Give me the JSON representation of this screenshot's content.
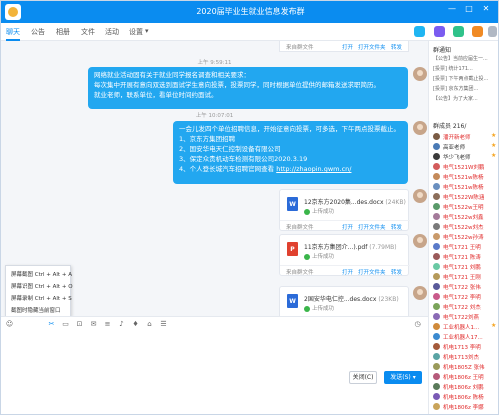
{
  "window": {
    "title": "2020届毕业生就业信息发布群",
    "controls": [
      "—",
      "□",
      "✕"
    ]
  },
  "tabs": [
    {
      "label": "聊天",
      "active": true
    },
    {
      "label": "公告"
    },
    {
      "label": "相册"
    },
    {
      "label": "文件"
    },
    {
      "label": "活动"
    },
    {
      "label": "设置"
    }
  ],
  "tab_settings_caret": "▾",
  "chat": {
    "top_file_footer": {
      "source": "来自群文件",
      "open": "打开",
      "open_folder": "打开文件夹",
      "forward": "转发"
    },
    "time1": "上午 9:59:11",
    "message1": [
      "网络就业活动固有关于就业同学报名调查和相关要求：",
      "每次集中开展有意向双选到面试学生意向投票，投票同学，同时根据单位提供的邮箱发送求职简历。",
      "就业老师，联系单位，看单位时间约面试。"
    ],
    "time2": "上午 10:07:01",
    "message2": {
      "intro": "一会儿发四个单位招聘信息，开始征意向投票，可多选，下午两点投票截止。",
      "items": [
        "1、京东方集团招聘",
        "2、国安华电天仁控制设备有限公司",
        "3、保定众贵机动车检测有限公司2020.3.19",
        "4、个人登长城汽车招聘官网查看"
      ],
      "link": "http://zhaopin.gwm.cn/"
    },
    "files": [
      {
        "name": "12京东方2020集...des.docx",
        "size": "(24KB)",
        "status": "上传成功",
        "type": "word"
      },
      {
        "name": "11京东方集团介...).pdf",
        "size": "(7.79MB)",
        "status": "上传成功",
        "type": "pdf"
      },
      {
        "name": "2国安华电仁控...des.docx",
        "size": "(23KB)",
        "status": "上传成功",
        "type": "word"
      }
    ],
    "file_footer": {
      "source": "来自群文件",
      "open": "打开",
      "open_folder": "打开文件夹",
      "forward": "转发"
    }
  },
  "context_menu": {
    "items": [
      "屏幕截图 Ctrl + Alt + A",
      "屏幕识图 Ctrl + Alt + O",
      "屏幕录制 Ctrl + Alt + S",
      "截图时隐藏当前窗口"
    ]
  },
  "toolbar": {
    "icons": [
      "☺",
      "✂",
      "▭",
      "⊡",
      "✉",
      "≡",
      "♪",
      "♦",
      "⌂",
      "☰"
    ],
    "history_icon": "◷"
  },
  "buttons": {
    "close": "关闭(C)",
    "send": "发送(S)",
    "send_caret": "▾"
  },
  "right_panel": {
    "notice_title": "群通知",
    "notice_lines": [
      "【公告】当前应届生一...",
      "[投票] 统计171... ",
      "[投票] 下午两点截止投...",
      "[投票] 京东方集团...",
      "【公告】为了大家..."
    ],
    "members_title": "群成员 216/",
    "members": [
      {
        "name": "潘开新老师",
        "color": "red",
        "avatar": "#7a5b44",
        "star": true
      },
      {
        "name": "高亚老师",
        "color": "dark",
        "avatar": "#4a7ab5",
        "star": true
      },
      {
        "name": "华少飞老师",
        "color": "dark",
        "avatar": "#3b3b3b",
        "star": true
      },
      {
        "name": "电气1521W刘鹏",
        "color": "red",
        "avatar": "#d35b5b",
        "star": false
      },
      {
        "name": "电气1521w陈杨",
        "color": "red",
        "avatar": "#c48a5a",
        "star": false
      },
      {
        "name": "电气1521w陈杨",
        "color": "red",
        "avatar": "#6a8fbf",
        "star": false
      },
      {
        "name": "电气1522W陈涵",
        "color": "red",
        "avatar": "#8c6e5a",
        "star": false
      },
      {
        "name": "电气1522w王明",
        "color": "red",
        "avatar": "#5a9a6a",
        "star": false
      },
      {
        "name": "电气1522w刘鑫",
        "color": "red",
        "avatar": "#a47a9a",
        "star": false
      },
      {
        "name": "电气1522w刘杰",
        "color": "red",
        "avatar": "#7a7a7a",
        "star": false
      },
      {
        "name": "电气1522w孙涛",
        "color": "red",
        "avatar": "#c99a6a",
        "star": false
      },
      {
        "name": "电气1721 王明",
        "color": "red",
        "avatar": "#5a7ac9",
        "star": false
      },
      {
        "name": "电气1721 陈涛",
        "color": "red",
        "avatar": "#9a5a5a",
        "star": false
      },
      {
        "name": "电气1721 刘鹏",
        "color": "red",
        "avatar": "#6ac9a4",
        "star": false
      },
      {
        "name": "电气1721 王刚",
        "color": "red",
        "avatar": "#b59a5a",
        "star": false
      },
      {
        "name": "电气1722 张伟",
        "color": "red",
        "avatar": "#5a5a9a",
        "star": false
      },
      {
        "name": "电气1722 李明",
        "color": "red",
        "avatar": "#c95a8a",
        "star": false
      },
      {
        "name": "电气1722 刘杰",
        "color": "red",
        "avatar": "#7aa45a",
        "star": false
      },
      {
        "name": "电气1722刘燕",
        "color": "red",
        "avatar": "#8a6ab5",
        "star": false
      },
      {
        "name": "工业机器人1...",
        "color": "red",
        "avatar": "#d08a3a",
        "star": true
      },
      {
        "name": "工业机器人17...",
        "color": "red",
        "avatar": "#3a8ad0",
        "star": false
      },
      {
        "name": "机电1713 李明",
        "color": "red",
        "avatar": "#a45a3a",
        "star": false
      },
      {
        "name": "机电1713刘杰",
        "color": "red",
        "avatar": "#5aa4a4",
        "star": false
      },
      {
        "name": "机电1805Z 张伟",
        "color": "red",
        "avatar": "#9a9a5a",
        "star": false
      },
      {
        "name": "机电1806z 王明",
        "color": "red",
        "avatar": "#b55a7a",
        "star": false
      },
      {
        "name": "机电1806z 刘鹏",
        "color": "red",
        "avatar": "#5a7a5a",
        "star": false
      },
      {
        "name": "机电1806z 陈杨",
        "color": "red",
        "avatar": "#7a5ab5",
        "star": false
      },
      {
        "name": "机电1806z 李娜",
        "color": "red",
        "avatar": "#c9a45a",
        "star": false
      }
    ]
  }
}
